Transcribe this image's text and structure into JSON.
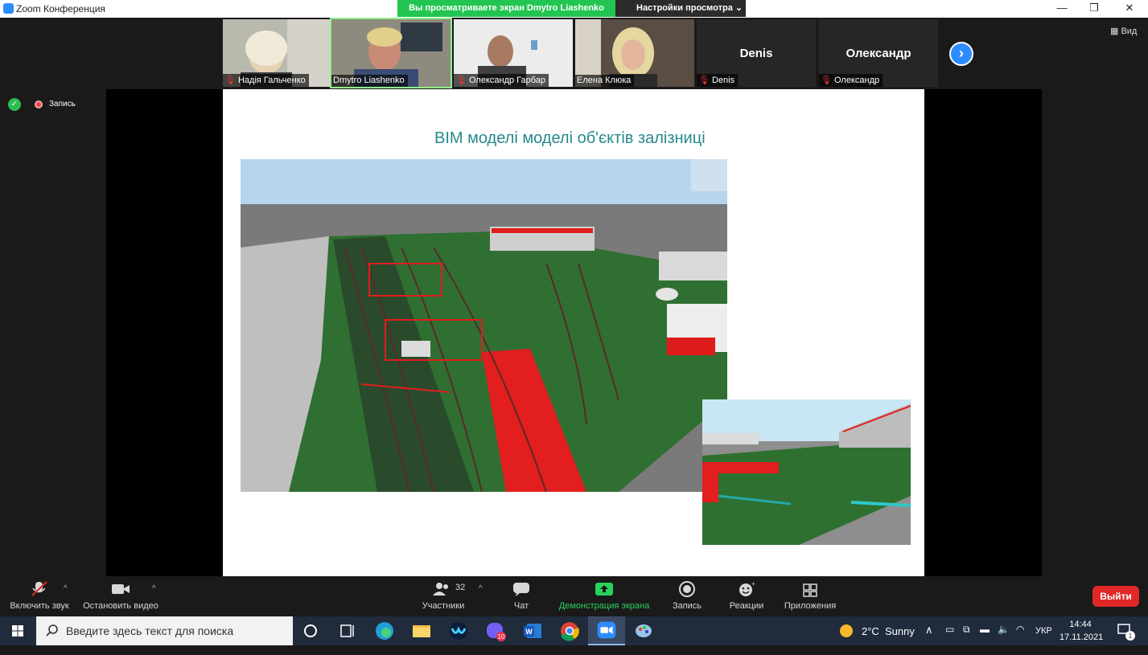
{
  "window": {
    "title": "Zoom Конференция",
    "share_banner": "Вы просматриваете экран Dmytro Liashenko",
    "view_settings": "Настройки просмотра",
    "view_settings_caret": "⌄",
    "minimize": "—",
    "maximize": "❐",
    "close": "✕"
  },
  "participants_strip": [
    {
      "name": "Надія Гальченко",
      "muted": true
    },
    {
      "name": "Dmytro Liashenko",
      "muted": false,
      "active": true
    },
    {
      "name": "Олександр Гарбар",
      "muted": true
    },
    {
      "name": "Елена Клюка",
      "muted": false
    },
    {
      "name": "Denis",
      "muted": true,
      "big_label": "Denis"
    },
    {
      "name": "Олександр",
      "muted": true,
      "big_label": "Олександр"
    }
  ],
  "mute_glyph": "🎙",
  "next_page_arrow": "›",
  "view_label": "Вид",
  "recording_label": "Запись",
  "slide": {
    "title": "BIM моделі моделі об'єктів залізниці"
  },
  "controls": {
    "unmute": "Включить звук",
    "stop_video": "Остановить видео",
    "participants": "Участники",
    "participants_count": "32",
    "chat": "Чат",
    "share_screen": "Демонстрация экрана",
    "record": "Запись",
    "reactions": "Реакции",
    "apps": "Приложения",
    "leave": "Выйти",
    "caret": "^"
  },
  "taskbar": {
    "search_placeholder": "Введите здесь текст для поиска",
    "weather_temp": "2°C",
    "weather_desc": "Sunny",
    "language": "УКР",
    "time": "14:44",
    "date": "17.11.2021",
    "viber_badge": "10",
    "notification_count": "1"
  },
  "colors": {
    "share_green": "#23c552",
    "zoom_blue": "#2d8cff",
    "leave_red": "#e02828",
    "slide_title": "#26898c"
  }
}
